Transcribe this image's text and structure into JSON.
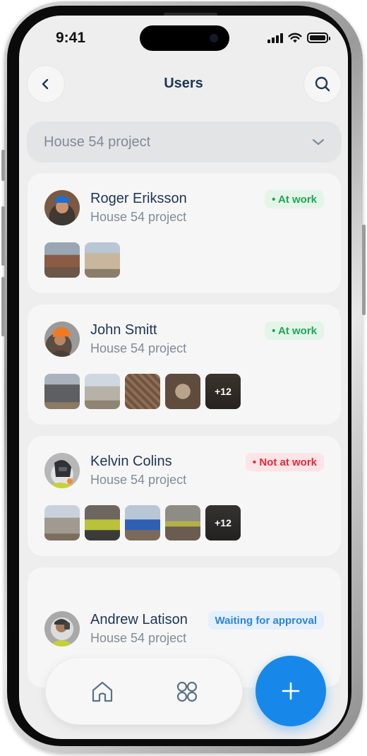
{
  "status_bar": {
    "time": "9:41"
  },
  "header": {
    "title": "Users"
  },
  "project_filter": {
    "selected": "House 54 project"
  },
  "users": [
    {
      "name": "Roger Eriksson",
      "project": "House 54 project",
      "status": "• At work",
      "status_color": "#22a556",
      "photos": [
        "construction-photo",
        "construction-photo"
      ],
      "more_count": ""
    },
    {
      "name": "John Smitt",
      "project": "House 54 project",
      "status": "• At work",
      "status_color": "#22a556",
      "photos": [
        "construction-photo",
        "construction-photo",
        "construction-photo",
        "construction-photo",
        "construction-photo"
      ],
      "more_count": "+12"
    },
    {
      "name": "Kelvin Colins",
      "project": "House 54 project",
      "status": "• Not at work",
      "status_color": "#e3283b",
      "photos": [
        "construction-photo",
        "construction-photo",
        "construction-photo",
        "construction-photo",
        "construction-photo"
      ],
      "more_count": "+12"
    },
    {
      "name": "Andrew Latison",
      "project": "House 54 project",
      "status": "Waiting for approval",
      "status_color": "#2f85d6",
      "photos": [],
      "more_count": ""
    }
  ],
  "bottom_nav": {
    "items": [
      {
        "icon": "home-icon"
      },
      {
        "icon": "apps-grid-icon"
      }
    ],
    "fab_icon": "plus-icon"
  },
  "colors": {
    "accent": "#1788ea",
    "title": "#1f3654",
    "secondary_text": "#7f8b99",
    "screen_background": "#eeeeee"
  }
}
